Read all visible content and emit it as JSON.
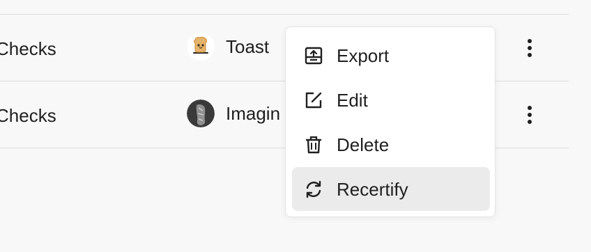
{
  "table": {
    "rows": [
      {
        "name": "Checks",
        "owner": "Toast",
        "avatar_icon": "toast-avatar",
        "more_icon": "vertical-ellipsis-icon"
      },
      {
        "name": "Checks",
        "owner": "Imagin",
        "avatar_icon": "photo-avatar",
        "more_icon": "vertical-ellipsis-icon"
      }
    ]
  },
  "menu": {
    "items": [
      {
        "label": "Export",
        "icon": "export-icon"
      },
      {
        "label": "Edit",
        "icon": "edit-icon"
      },
      {
        "label": "Delete",
        "icon": "trash-icon"
      },
      {
        "label": "Recertify",
        "icon": "refresh-icon",
        "active": true
      }
    ]
  },
  "colors": {
    "background": "#f8f8f8",
    "text": "#1f1f1f",
    "divider": "#dcdcdc",
    "menu_background": "#ffffff",
    "menu_highlight": "#ebebeb"
  }
}
